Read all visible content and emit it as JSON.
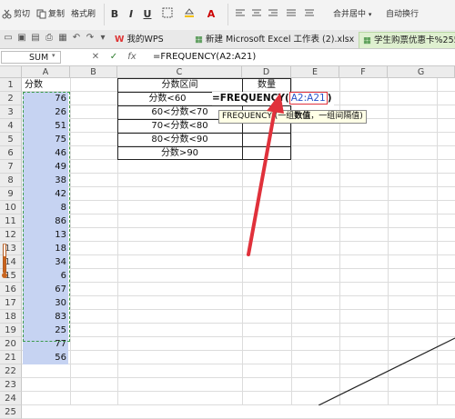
{
  "ribbon": {
    "cut": "剪切",
    "copy": "复制",
    "format_painter": "格式刷",
    "bold": "B",
    "italic": "I",
    "underline": "U",
    "merge_center": "合并居中",
    "wrap_text": "自动换行"
  },
  "tabs": [
    {
      "label": "我的WPS"
    },
    {
      "label": "新建 Microsoft Excel 工作表 (2).xlsx"
    },
    {
      "label": "学生购票优惠卡%255"
    }
  ],
  "formula_bar": {
    "name_box": "SUM",
    "cancel": "✕",
    "confirm": "✓",
    "fx": "fx",
    "formula": "=FREQUENCY(A2:A21)"
  },
  "columns": [
    "A",
    "B",
    "C",
    "D",
    "E",
    "F",
    "G"
  ],
  "rows": [
    "1",
    "2",
    "3",
    "4",
    "5",
    "6",
    "7",
    "8",
    "9",
    "10",
    "11",
    "12",
    "13",
    "14",
    "15",
    "16",
    "17",
    "18",
    "19",
    "20",
    "21",
    "22",
    "23",
    "24",
    "25"
  ],
  "column_a": {
    "header": "分数",
    "values": [
      "76",
      "26",
      "51",
      "75",
      "46",
      "49",
      "38",
      "42",
      "8",
      "86",
      "13",
      "18",
      "34",
      "6",
      "67",
      "30",
      "83",
      "25",
      "77",
      "56"
    ]
  },
  "table": {
    "header_c": "分数区间",
    "header_d": "数量",
    "intervals": [
      "分数<60",
      "60<分数<70",
      "70<分数<80",
      "80<分数<90",
      "分数>90"
    ]
  },
  "editing": {
    "formula_prefix": "=FREQUENCY(",
    "formula_ref": "A2:A21",
    "formula_suffix": ")",
    "tooltip_prefix": "FREQUENCY (",
    "tooltip_mid": "一组",
    "tooltip_bold": "数值",
    "tooltip_rest": "，一组间隔值)"
  },
  "colors": {
    "selection": "#c6d3f2",
    "red_annotation": "#e0313b",
    "tab_active": "#dff0d0"
  }
}
